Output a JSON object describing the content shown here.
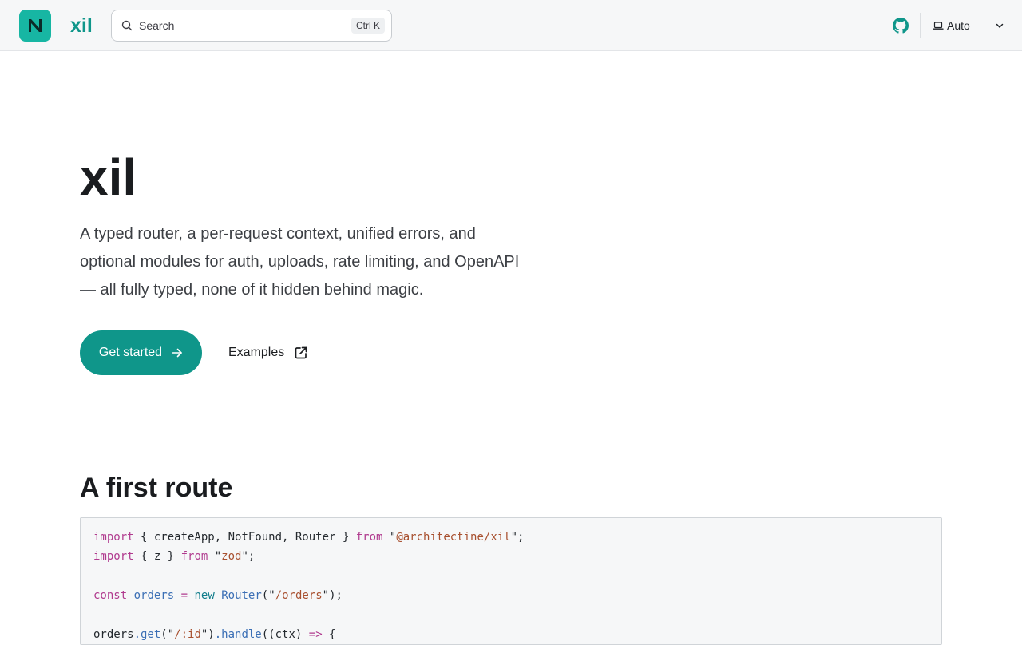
{
  "header": {
    "brand": "xil",
    "search": {
      "placeholder": "Search",
      "shortcut": "Ctrl K"
    },
    "appearance": {
      "label": "Auto"
    }
  },
  "hero": {
    "title": "xil",
    "description": "A typed router, a per-request context, unified errors, and optional modules for auth, uploads, rate limiting, and OpenAPI — all fully typed, none of it hidden behind magic.",
    "primary_button": "Get started",
    "secondary_button": "Examples"
  },
  "section": {
    "title": "A first route"
  },
  "code": {
    "lines": [
      [
        [
          "kw",
          "import"
        ],
        [
          "p",
          " { createApp, NotFound, Router } "
        ],
        [
          "kw",
          "from"
        ],
        [
          "p",
          " \""
        ],
        [
          "str",
          "@architectine/xil"
        ],
        [
          "p",
          "\";"
        ]
      ],
      [
        [
          "kw",
          "import"
        ],
        [
          "p",
          " { z } "
        ],
        [
          "kw",
          "from"
        ],
        [
          "p",
          " \""
        ],
        [
          "str",
          "zod"
        ],
        [
          "p",
          "\";"
        ]
      ],
      [],
      [
        [
          "kw",
          "const"
        ],
        [
          "p",
          " "
        ],
        [
          "fn",
          "orders"
        ],
        [
          "p",
          " "
        ],
        [
          "kw",
          "="
        ],
        [
          "p",
          " "
        ],
        [
          "cls",
          "new"
        ],
        [
          "p",
          " "
        ],
        [
          "fn",
          "Router"
        ],
        [
          "p",
          "(\""
        ],
        [
          "str",
          "/orders"
        ],
        [
          "p",
          "\");"
        ]
      ],
      [],
      [
        [
          "p",
          "orders"
        ],
        [
          "fn",
          ".get"
        ],
        [
          "p",
          "(\""
        ],
        [
          "str",
          "/:id"
        ],
        [
          "p",
          "\")"
        ],
        [
          "fn",
          ".handle"
        ],
        [
          "p",
          "((ctx) "
        ],
        [
          "kw",
          "=>"
        ],
        [
          "p",
          " {"
        ]
      ]
    ]
  },
  "colors": {
    "accent": "#0f968a",
    "logo": "#17b6a3"
  }
}
